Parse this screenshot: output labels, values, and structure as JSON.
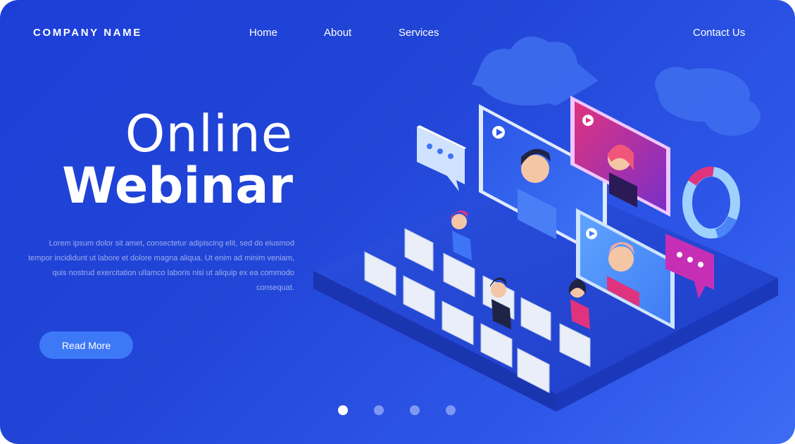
{
  "header": {
    "brand": "COMPANY NAME",
    "nav": [
      {
        "label": "Home"
      },
      {
        "label": "About"
      },
      {
        "label": "Services"
      },
      {
        "label": "Contact Us"
      }
    ]
  },
  "hero": {
    "title_line1": "Online",
    "title_line2": "Webinar",
    "description": "Lorem ipsum dolor sit amet, consectetur adipiscing elit, sed do eiusmod tempor incididunt ut labore et dolore magna aliqua. Ut enim ad minim veniam, quis nostrud exercitation ullamco laboris nisi ut aliquip ex ea commodo consequat.",
    "cta_label": "Read More"
  },
  "slider": {
    "count": 4,
    "active_index": 0
  },
  "colors": {
    "background": "#2145d6",
    "button": "#3d78f7",
    "accent_pink": "#e0337e",
    "accent_light_blue": "#6fb3ff"
  },
  "illustration": {
    "icons": [
      "cloud-icon",
      "chat-bubble-icon",
      "video-screen-icon",
      "donut-chart-icon",
      "chair-icon",
      "person-icon"
    ]
  }
}
